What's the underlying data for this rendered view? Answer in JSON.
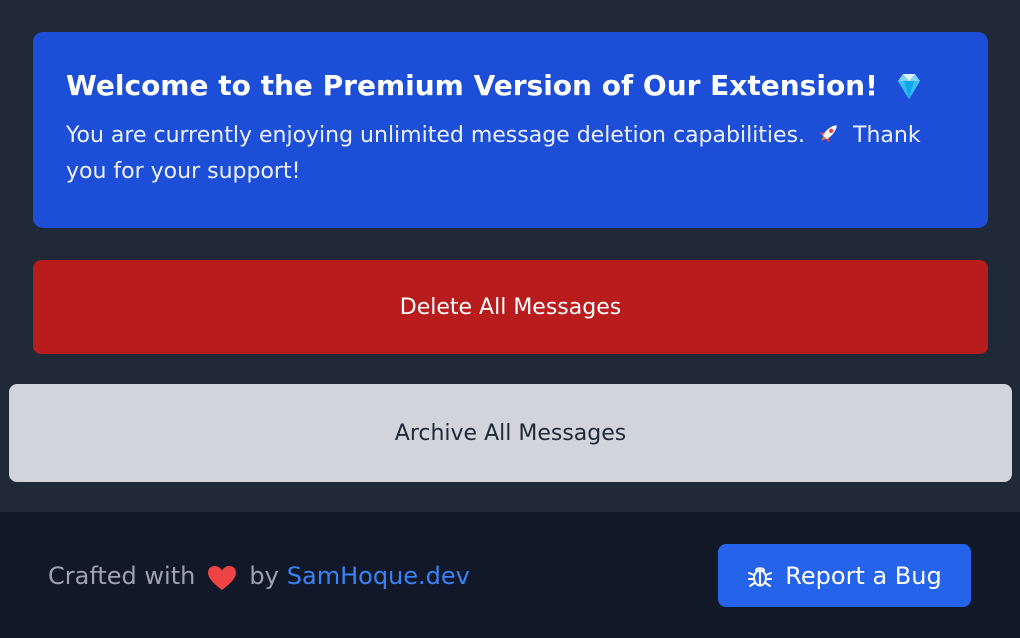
{
  "premium": {
    "title": "Welcome to the Premium Version of Our Extension!",
    "title_icon": "diamond-icon",
    "text_before": "You are currently enjoying unlimited message deletion capabilities.",
    "text_icon": "rocket-icon",
    "text_after": "Thank you for your support!"
  },
  "actions": {
    "delete_label": "Delete All Messages",
    "archive_label": "Archive All Messages"
  },
  "footer": {
    "crafted_label": "Crafted with",
    "heart_icon": "heart-icon",
    "by_label": "by",
    "author_link": "SamHoque.dev",
    "report_label": "Report a Bug",
    "report_icon": "bug-icon"
  },
  "colors": {
    "background": "#1f2937",
    "footer_background": "#111827",
    "premium_card": "#1d4ed8",
    "delete_button": "#b91c1c",
    "archive_button": "#d1d5db",
    "report_button": "#2563eb",
    "link": "#3b82f6"
  }
}
